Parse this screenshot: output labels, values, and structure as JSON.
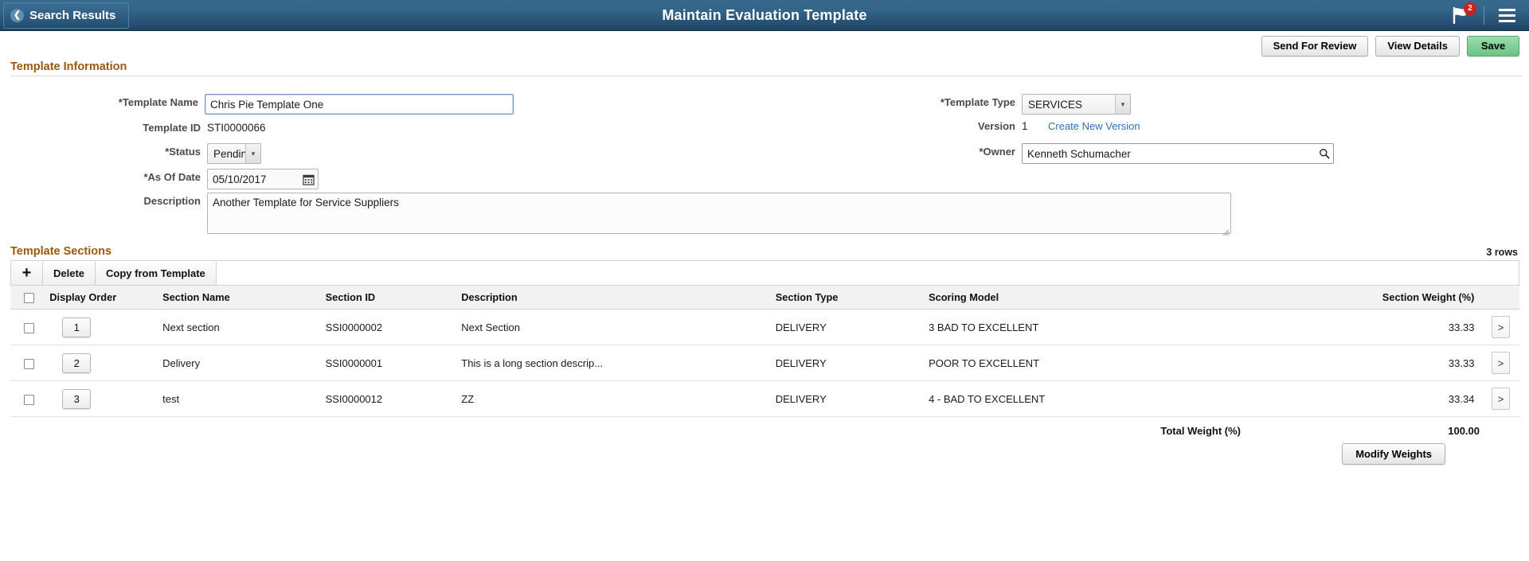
{
  "topbar": {
    "back_label": "Search Results",
    "back_icon": "chevron-left-icon",
    "title": "Maintain Evaluation Template",
    "notification_icon": "flag-icon",
    "notification_count": "2",
    "menu_icon": "hamburger-menu-icon"
  },
  "actions": {
    "send_for_review": "Send For Review",
    "view_details": "View Details",
    "save": "Save"
  },
  "template_information": {
    "heading": "Template Information",
    "template_name_label": "Template Name",
    "template_name_value": "Chris Pie Template One",
    "template_id_label": "Template ID",
    "template_id_value": "STI0000066",
    "status_label": "Status",
    "status_value": "Pending",
    "as_of_date_label": "As Of Date",
    "as_of_date_value": "05/10/2017",
    "calendar_icon": "calendar-icon",
    "description_label": "Description",
    "description_value": "Another Template for Service Suppliers",
    "template_type_label": "Template Type",
    "template_type_value": "SERVICES",
    "version_label": "Version",
    "version_value": "1",
    "create_new_version_link": "Create New Version",
    "owner_label": "Owner",
    "owner_value": "Kenneth Schumacher",
    "owner_search_icon": "search-icon"
  },
  "template_sections": {
    "heading": "Template Sections",
    "rows_count": "3 rows",
    "toolbar": {
      "add_label": "+",
      "delete_label": "Delete",
      "copy_label": "Copy from Template"
    },
    "columns": [
      "Display Order",
      "Section Name",
      "Section ID",
      "Description",
      "Section Type",
      "Scoring Model",
      "Section Weight (%)"
    ],
    "rows": [
      {
        "display_order": "1",
        "section_name": "Next section",
        "section_id": "SSI0000002",
        "description": "Next Section",
        "section_type": "DELIVERY",
        "scoring_model": "3 BAD TO EXCELLENT",
        "section_weight": "33.33",
        "detail_arrow": ">"
      },
      {
        "display_order": "2",
        "section_name": "Delivery",
        "section_id": "SSI0000001",
        "description": "This is a long section descrip...",
        "section_type": "DELIVERY",
        "scoring_model": "POOR  TO EXCELLENT",
        "section_weight": "33.33",
        "detail_arrow": ">"
      },
      {
        "display_order": "3",
        "section_name": "test",
        "section_id": "SSI0000012",
        "description": "ZZ",
        "section_type": "DELIVERY",
        "scoring_model": "4 - BAD TO EXCELLENT",
        "section_weight": "33.34",
        "detail_arrow": ">"
      }
    ],
    "total_weight_label": "Total Weight (%)",
    "total_weight_value": "100.00",
    "modify_weights_label": "Modify Weights"
  },
  "colors": {
    "header_blue": "#33658a",
    "heading_brown": "#9c5810",
    "save_green": "#7fcf96",
    "link_blue": "#2e6fb7",
    "badge_red": "#d0201a"
  }
}
